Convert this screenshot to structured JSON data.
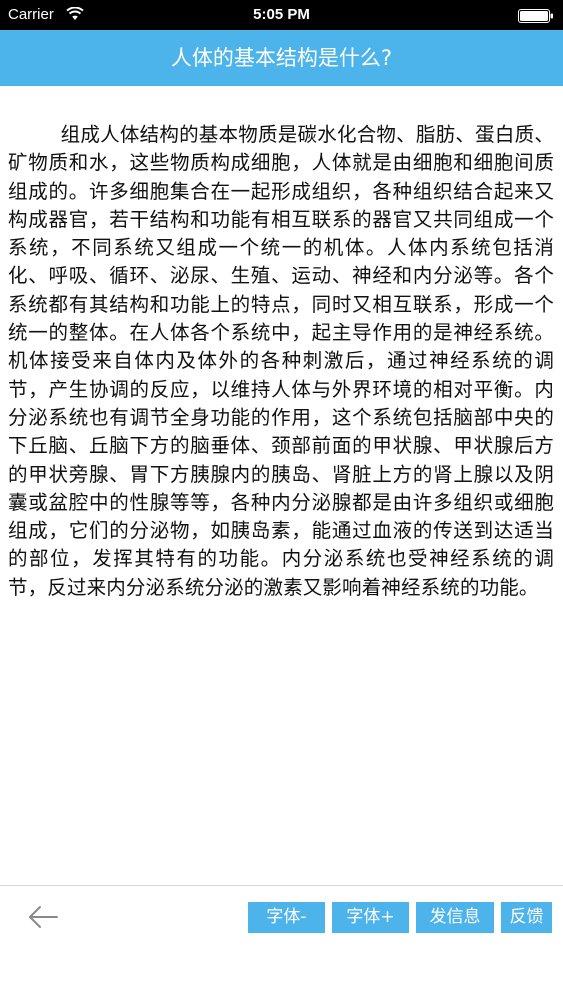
{
  "status_bar": {
    "carrier": "Carrier",
    "time": "5:05 PM",
    "icons": [
      "wifi-icon",
      "battery-icon"
    ]
  },
  "nav": {
    "title": "人体的基本结构是什么?"
  },
  "article": {
    "body": "组成人体结构的基本物质是碳水化合物、脂肪、蛋白质、矿物质和水，这些物质构成细胞，人体就是由细胞和细胞间质组成的。许多细胞集合在一起形成组织，各种组织结合起来又构成器官，若干结构和功能有相互联系的器官又共同组成一个系统，不同系统又组成一个统一的机体。人体内系统包括消化、呼吸、循环、泌尿、生殖、运动、神经和内分泌等。各个系统都有其结构和功能上的特点，同时又相互联系，形成一个统一的整体。在人体各个系统中，起主导作用的是神经系统。机体接受来自体内及体外的各种刺激后，通过神经系统的调节，产生协调的反应，以维持人体与外界环境的相对平衡。内分泌系统也有调节全身功能的作用，这个系统包括脑部中央的下丘脑、丘脑下方的脑垂体、颈部前面的甲状腺、甲状腺后方的甲状旁腺、胃下方胰腺内的胰岛、肾脏上方的肾上腺以及阴囊或盆腔中的性腺等等，各种内分泌腺都是由许多组织或细胞组成，它们的分泌物，如胰岛素，能通过血液的传送到达适当的部位，发挥其特有的功能。内分泌系统也受神经系统的调节，反过来内分泌系统分泌的激素又影响着神经系统的功能。"
  },
  "toolbar": {
    "back_icon": "arrow-left-icon",
    "font_decrease_label": "字体-",
    "font_increase_label": "字体+",
    "send_message_label": "发信息",
    "feedback_label": "反馈"
  },
  "colors": {
    "accent": "#4cb3eb",
    "status_bar_bg": "#000000",
    "text": "#111111",
    "divider": "#d8d8d8"
  }
}
